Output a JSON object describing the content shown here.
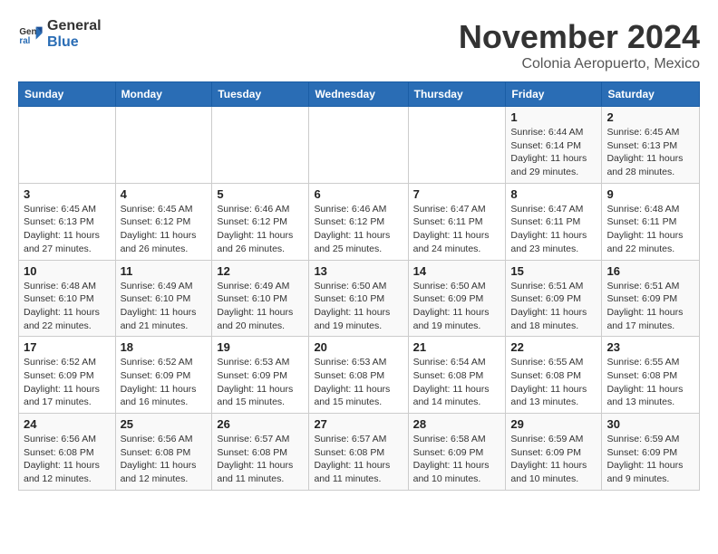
{
  "logo": {
    "general": "General",
    "blue": "Blue"
  },
  "title": "November 2024",
  "subtitle": "Colonia Aeropuerto, Mexico",
  "days_of_week": [
    "Sunday",
    "Monday",
    "Tuesday",
    "Wednesday",
    "Thursday",
    "Friday",
    "Saturday"
  ],
  "weeks": [
    [
      {
        "day": "",
        "info": ""
      },
      {
        "day": "",
        "info": ""
      },
      {
        "day": "",
        "info": ""
      },
      {
        "day": "",
        "info": ""
      },
      {
        "day": "",
        "info": ""
      },
      {
        "day": "1",
        "info": "Sunrise: 6:44 AM\nSunset: 6:14 PM\nDaylight: 11 hours and 29 minutes."
      },
      {
        "day": "2",
        "info": "Sunrise: 6:45 AM\nSunset: 6:13 PM\nDaylight: 11 hours and 28 minutes."
      }
    ],
    [
      {
        "day": "3",
        "info": "Sunrise: 6:45 AM\nSunset: 6:13 PM\nDaylight: 11 hours and 27 minutes."
      },
      {
        "day": "4",
        "info": "Sunrise: 6:45 AM\nSunset: 6:12 PM\nDaylight: 11 hours and 26 minutes."
      },
      {
        "day": "5",
        "info": "Sunrise: 6:46 AM\nSunset: 6:12 PM\nDaylight: 11 hours and 26 minutes."
      },
      {
        "day": "6",
        "info": "Sunrise: 6:46 AM\nSunset: 6:12 PM\nDaylight: 11 hours and 25 minutes."
      },
      {
        "day": "7",
        "info": "Sunrise: 6:47 AM\nSunset: 6:11 PM\nDaylight: 11 hours and 24 minutes."
      },
      {
        "day": "8",
        "info": "Sunrise: 6:47 AM\nSunset: 6:11 PM\nDaylight: 11 hours and 23 minutes."
      },
      {
        "day": "9",
        "info": "Sunrise: 6:48 AM\nSunset: 6:11 PM\nDaylight: 11 hours and 22 minutes."
      }
    ],
    [
      {
        "day": "10",
        "info": "Sunrise: 6:48 AM\nSunset: 6:10 PM\nDaylight: 11 hours and 22 minutes."
      },
      {
        "day": "11",
        "info": "Sunrise: 6:49 AM\nSunset: 6:10 PM\nDaylight: 11 hours and 21 minutes."
      },
      {
        "day": "12",
        "info": "Sunrise: 6:49 AM\nSunset: 6:10 PM\nDaylight: 11 hours and 20 minutes."
      },
      {
        "day": "13",
        "info": "Sunrise: 6:50 AM\nSunset: 6:10 PM\nDaylight: 11 hours and 19 minutes."
      },
      {
        "day": "14",
        "info": "Sunrise: 6:50 AM\nSunset: 6:09 PM\nDaylight: 11 hours and 19 minutes."
      },
      {
        "day": "15",
        "info": "Sunrise: 6:51 AM\nSunset: 6:09 PM\nDaylight: 11 hours and 18 minutes."
      },
      {
        "day": "16",
        "info": "Sunrise: 6:51 AM\nSunset: 6:09 PM\nDaylight: 11 hours and 17 minutes."
      }
    ],
    [
      {
        "day": "17",
        "info": "Sunrise: 6:52 AM\nSunset: 6:09 PM\nDaylight: 11 hours and 17 minutes."
      },
      {
        "day": "18",
        "info": "Sunrise: 6:52 AM\nSunset: 6:09 PM\nDaylight: 11 hours and 16 minutes."
      },
      {
        "day": "19",
        "info": "Sunrise: 6:53 AM\nSunset: 6:09 PM\nDaylight: 11 hours and 15 minutes."
      },
      {
        "day": "20",
        "info": "Sunrise: 6:53 AM\nSunset: 6:08 PM\nDaylight: 11 hours and 15 minutes."
      },
      {
        "day": "21",
        "info": "Sunrise: 6:54 AM\nSunset: 6:08 PM\nDaylight: 11 hours and 14 minutes."
      },
      {
        "day": "22",
        "info": "Sunrise: 6:55 AM\nSunset: 6:08 PM\nDaylight: 11 hours and 13 minutes."
      },
      {
        "day": "23",
        "info": "Sunrise: 6:55 AM\nSunset: 6:08 PM\nDaylight: 11 hours and 13 minutes."
      }
    ],
    [
      {
        "day": "24",
        "info": "Sunrise: 6:56 AM\nSunset: 6:08 PM\nDaylight: 11 hours and 12 minutes."
      },
      {
        "day": "25",
        "info": "Sunrise: 6:56 AM\nSunset: 6:08 PM\nDaylight: 11 hours and 12 minutes."
      },
      {
        "day": "26",
        "info": "Sunrise: 6:57 AM\nSunset: 6:08 PM\nDaylight: 11 hours and 11 minutes."
      },
      {
        "day": "27",
        "info": "Sunrise: 6:57 AM\nSunset: 6:08 PM\nDaylight: 11 hours and 11 minutes."
      },
      {
        "day": "28",
        "info": "Sunrise: 6:58 AM\nSunset: 6:09 PM\nDaylight: 11 hours and 10 minutes."
      },
      {
        "day": "29",
        "info": "Sunrise: 6:59 AM\nSunset: 6:09 PM\nDaylight: 11 hours and 10 minutes."
      },
      {
        "day": "30",
        "info": "Sunrise: 6:59 AM\nSunset: 6:09 PM\nDaylight: 11 hours and 9 minutes."
      }
    ]
  ]
}
